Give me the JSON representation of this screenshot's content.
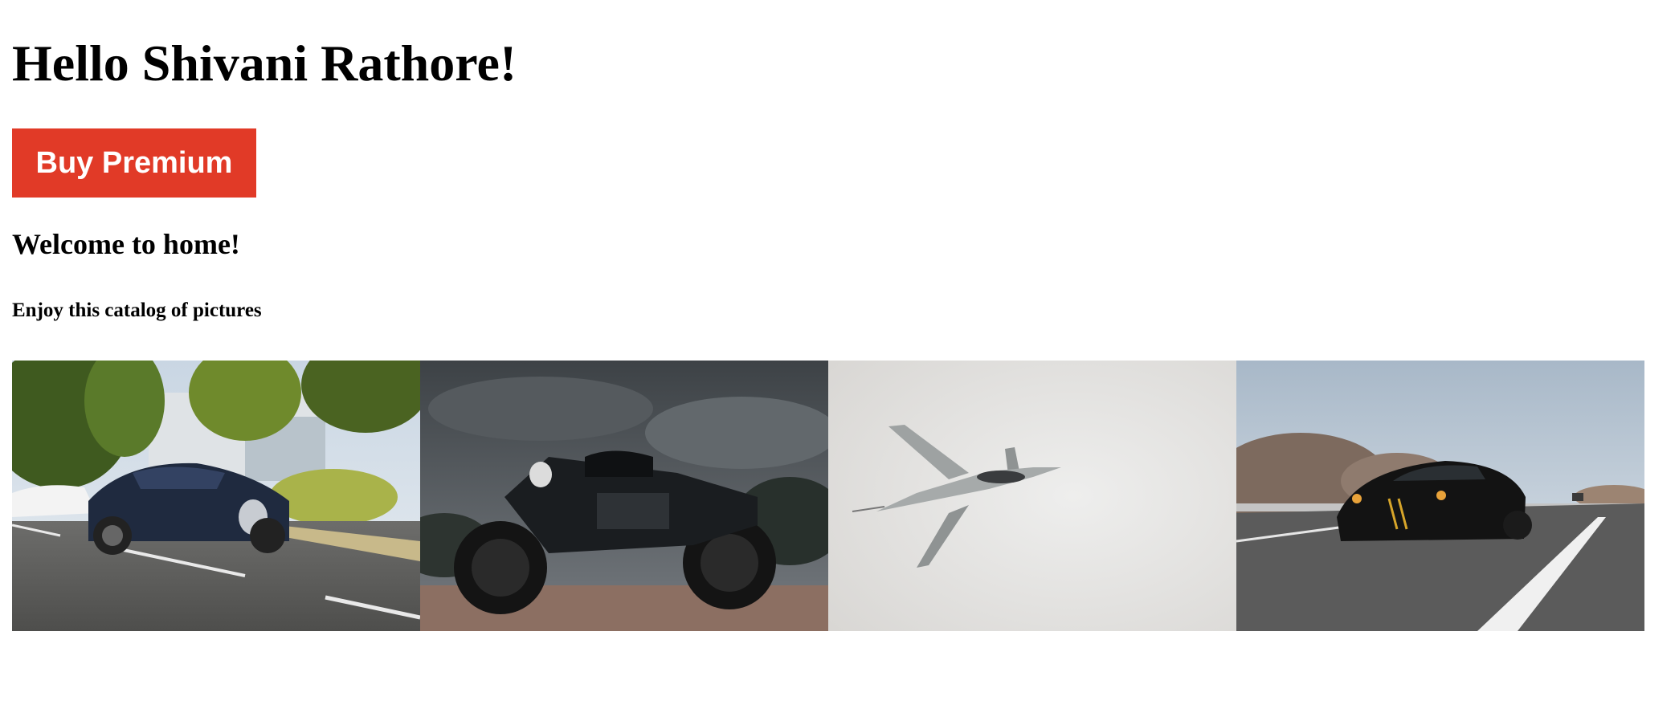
{
  "header": {
    "greeting": "Hello Shivani Rathore!"
  },
  "premium": {
    "label": "Buy Premium",
    "color": "#e13a27"
  },
  "main": {
    "welcome": "Welcome to home!",
    "subtitle": "Enjoy this catalog of pictures"
  },
  "gallery": {
    "images": [
      {
        "subject": "blue-sports-car-photo"
      },
      {
        "subject": "black-motorcycle-photo"
      },
      {
        "subject": "fighter-jet-photo"
      },
      {
        "subject": "black-muscle-car-photo"
      }
    ]
  }
}
